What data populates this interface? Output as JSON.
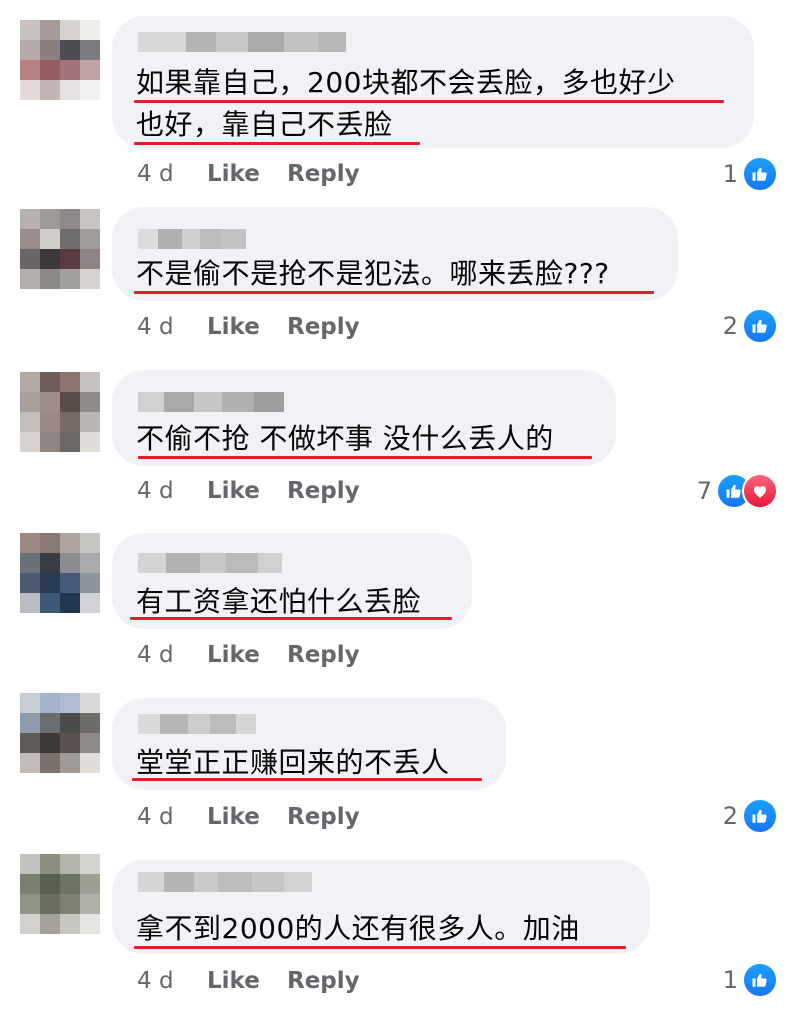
{
  "comments": [
    {
      "lines": [
        "如果靠自己，200块都不会丢脸，多也好少",
        "也好，靠自己不丢脸"
      ],
      "age": "4 d",
      "like_label": "Like",
      "reply_label": "Reply",
      "reaction_count": "1",
      "reactions": [
        "like"
      ]
    },
    {
      "lines": [
        "不是偷不是抢不是犯法。哪来丢脸???"
      ],
      "age": "4 d",
      "like_label": "Like",
      "reply_label": "Reply",
      "reaction_count": "2",
      "reactions": [
        "like"
      ]
    },
    {
      "lines": [
        "不偷不抢 不做坏事 没什么丢人的"
      ],
      "age": "4 d",
      "like_label": "Like",
      "reply_label": "Reply",
      "reaction_count": "7",
      "reactions": [
        "like",
        "love"
      ]
    },
    {
      "lines": [
        "有工资拿还怕什么丢脸"
      ],
      "age": "4 d",
      "like_label": "Like",
      "reply_label": "Reply",
      "reaction_count": "",
      "reactions": []
    },
    {
      "lines": [
        "堂堂正正赚回来的不丢人"
      ],
      "age": "4 d",
      "like_label": "Like",
      "reply_label": "Reply",
      "reaction_count": "2",
      "reactions": [
        "like"
      ]
    },
    {
      "lines": [
        "拿不到2000的人还有很多人。加油"
      ],
      "age": "4 d",
      "like_label": "Like",
      "reply_label": "Reply",
      "reaction_count": "1",
      "reactions": [
        "like"
      ]
    }
  ],
  "colors": {
    "bubble": "#f0f2f5",
    "underline": "#e41e26",
    "meta_text": "#65676b",
    "like_blue": "#1877f2",
    "love_red": "#e61739"
  },
  "icons": {
    "like": "thumbs-up-icon",
    "love": "heart-icon"
  }
}
